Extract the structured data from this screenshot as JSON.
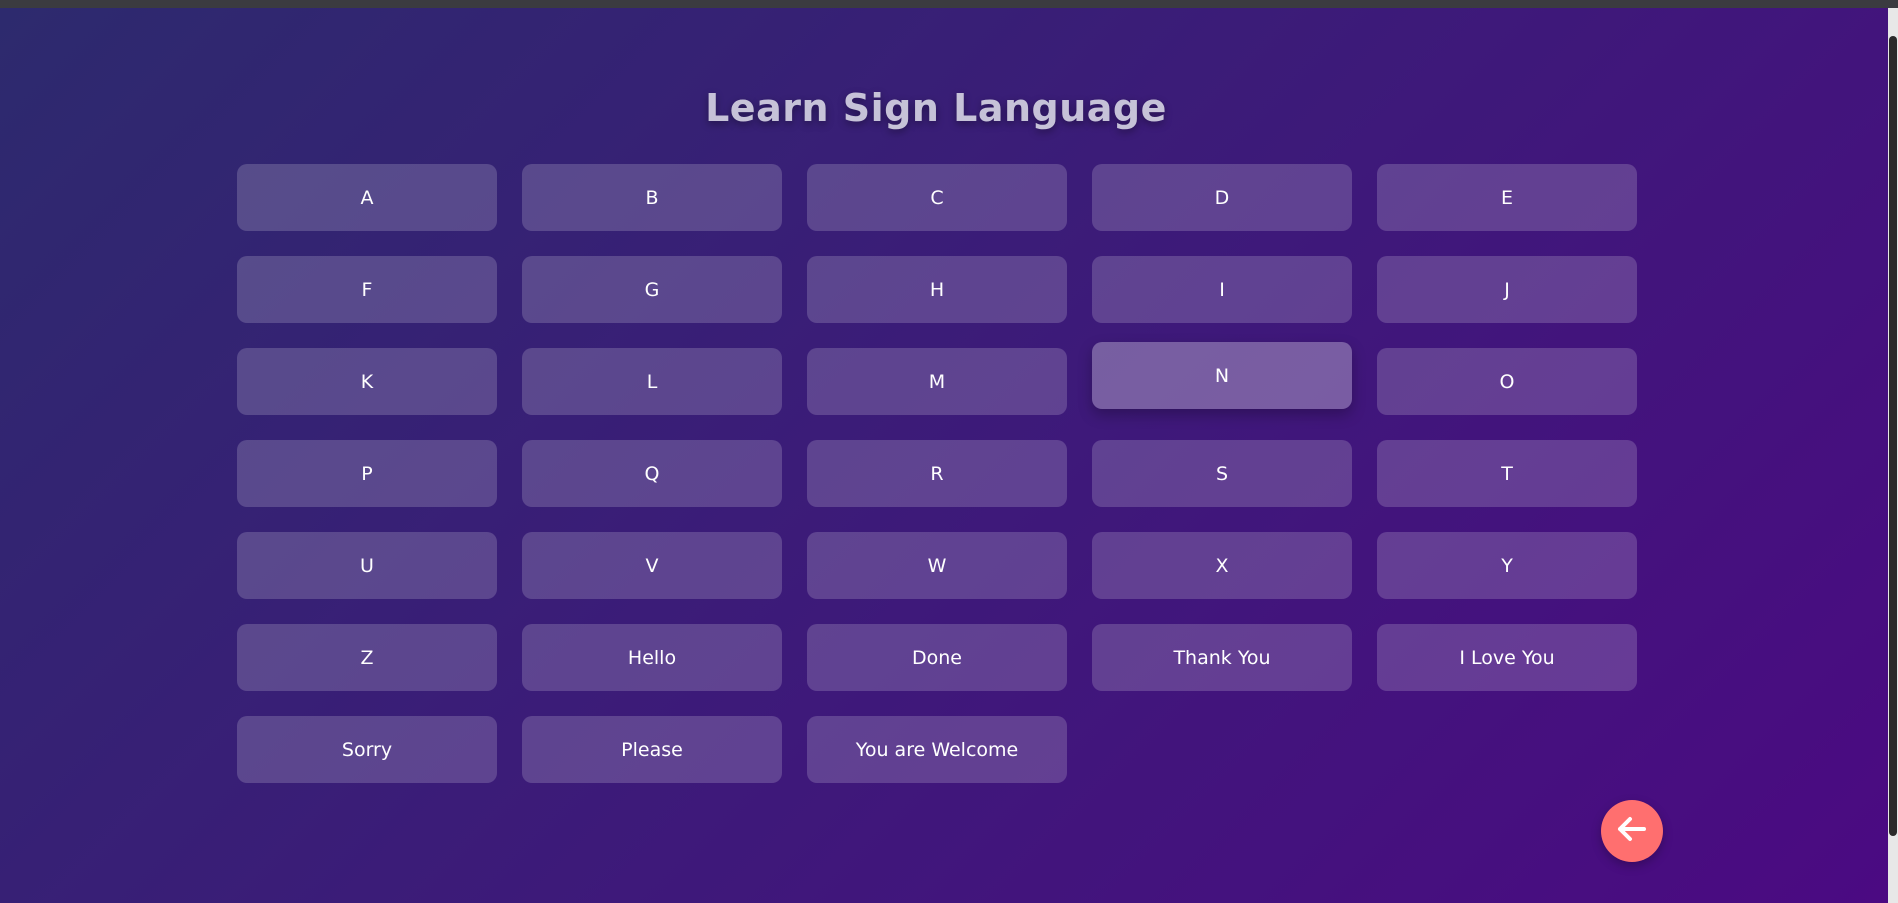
{
  "page": {
    "title": "Learn Sign Language"
  },
  "signs": [
    {
      "label": "A"
    },
    {
      "label": "B"
    },
    {
      "label": "C"
    },
    {
      "label": "D"
    },
    {
      "label": "E"
    },
    {
      "label": "F"
    },
    {
      "label": "G"
    },
    {
      "label": "H"
    },
    {
      "label": "I"
    },
    {
      "label": "J"
    },
    {
      "label": "K"
    },
    {
      "label": "L"
    },
    {
      "label": "M"
    },
    {
      "label": "N",
      "active": true
    },
    {
      "label": "O"
    },
    {
      "label": "P"
    },
    {
      "label": "Q"
    },
    {
      "label": "R"
    },
    {
      "label": "S"
    },
    {
      "label": "T"
    },
    {
      "label": "U"
    },
    {
      "label": "V"
    },
    {
      "label": "W"
    },
    {
      "label": "X"
    },
    {
      "label": "Y"
    },
    {
      "label": "Z"
    },
    {
      "label": "Hello"
    },
    {
      "label": "Done"
    },
    {
      "label": "Thank You"
    },
    {
      "label": "I Love You"
    },
    {
      "label": "Sorry"
    },
    {
      "label": "Please"
    },
    {
      "label": "You are Welcome"
    }
  ],
  "back_button": {
    "icon": "arrow-left-icon"
  },
  "colors": {
    "accent": "#ff6f6f",
    "background_start": "#2d2a6e",
    "background_end": "#4b0a82",
    "title": "#c6c2d8"
  }
}
